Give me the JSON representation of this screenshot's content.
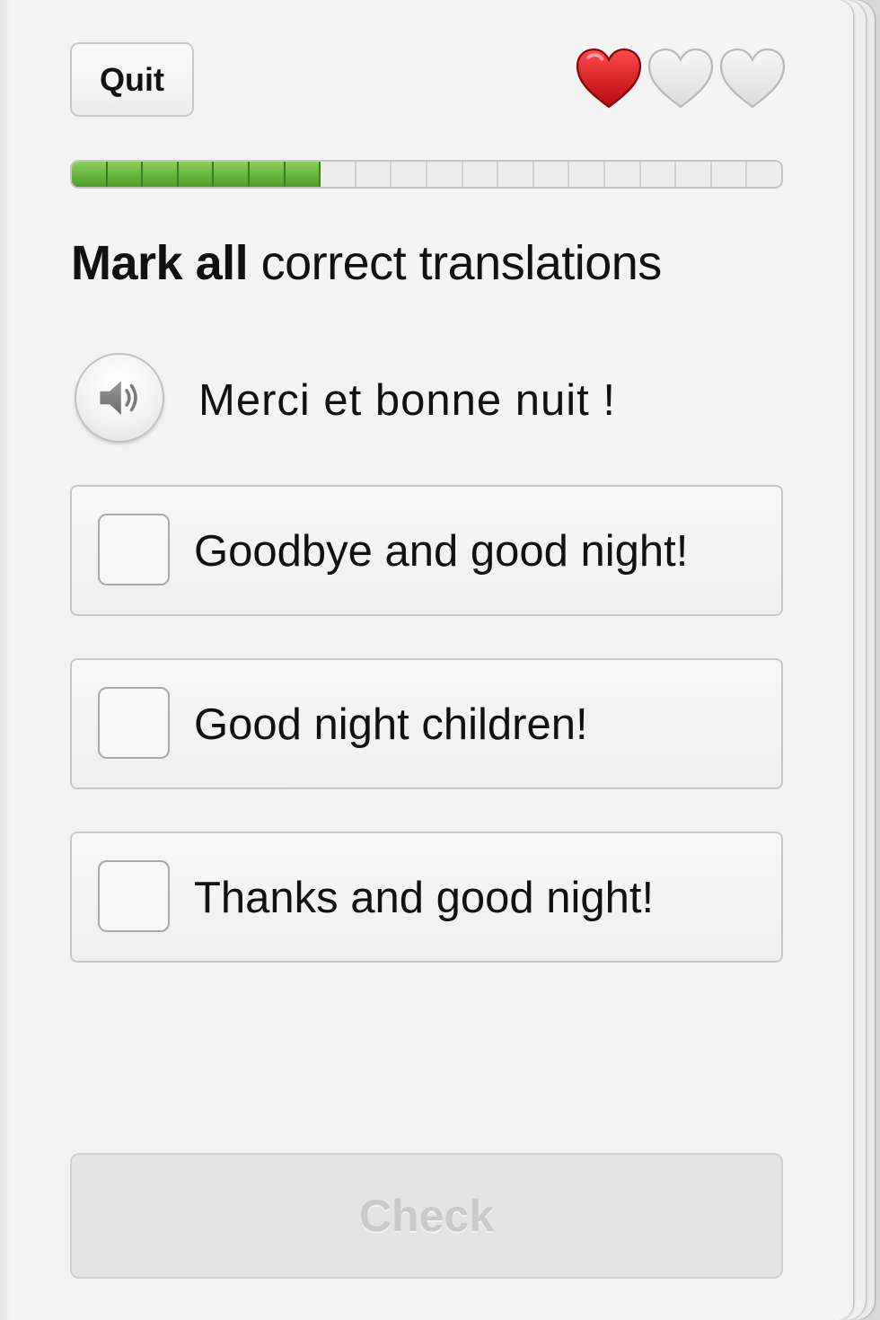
{
  "header": {
    "quit_label": "Quit",
    "lives": {
      "total": 3,
      "remaining": 1,
      "full_color": "#d8131a",
      "empty_color": "#e5e5e5"
    }
  },
  "progress": {
    "segments_total": 20,
    "segments_completed": 7,
    "fill_color": "#5aad33"
  },
  "instruction": {
    "bold_part": "Mark all",
    "rest": " correct translations"
  },
  "prompt": {
    "sentence": "Merci et bonne nuit !",
    "audio_icon": "speaker-icon"
  },
  "options": [
    {
      "label": "Goodbye and good night!",
      "checked": false
    },
    {
      "label": "Good night children!",
      "checked": false
    },
    {
      "label": "Thanks and good night!",
      "checked": false
    }
  ],
  "footer": {
    "check_label": "Check",
    "check_enabled": false
  }
}
